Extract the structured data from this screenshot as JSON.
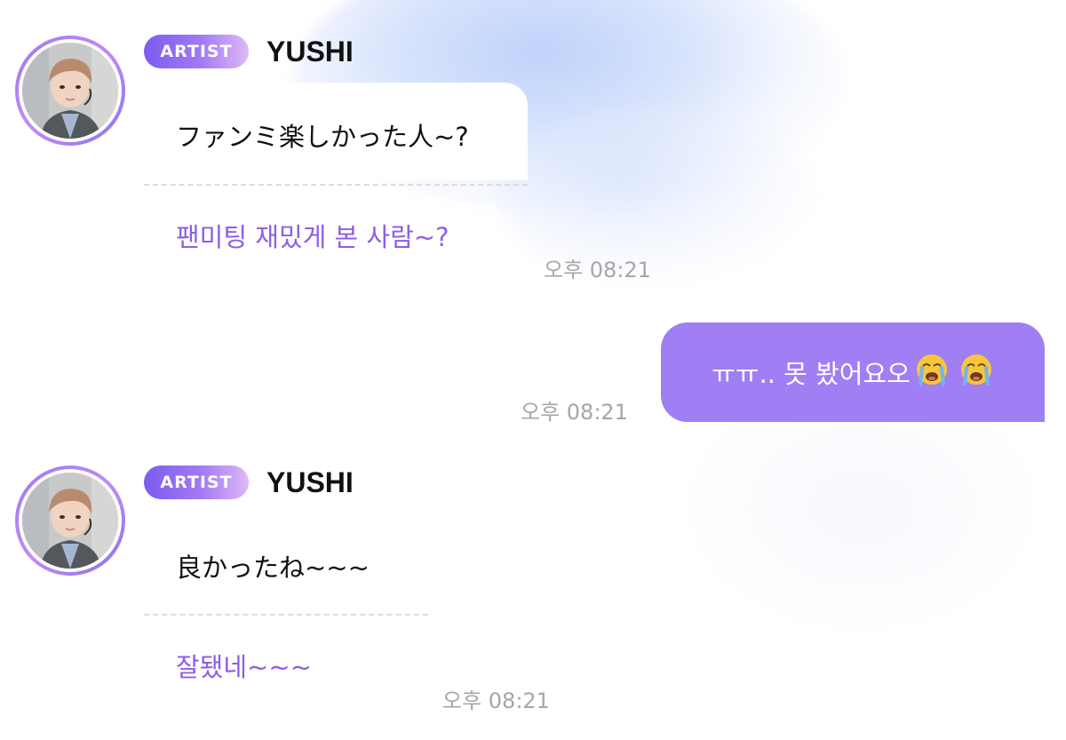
{
  "messages": [
    {
      "sender": {
        "badge": "ARTIST",
        "name": "YUSHI"
      },
      "text": "ファンミ楽しかった人~?",
      "translation": "팬미팅 재밌게 본 사람~?",
      "time": "오후 08:21"
    },
    {
      "text": "ㅠㅠ.. 못 봤어요오",
      "emojis": [
        "loudly-crying-face-icon",
        "loudly-crying-face-icon"
      ],
      "time": "오후 08:21"
    },
    {
      "sender": {
        "badge": "ARTIST",
        "name": "YUSHI"
      },
      "text": "良かったね~~~",
      "translation": "잘됐네~~~",
      "time": "오후 08:21"
    }
  ],
  "colors": {
    "accent": "#a07ef4",
    "translation": "#8d5ee8",
    "timestamp": "#a6a6a6",
    "background_glow": "#c8d8fa"
  }
}
